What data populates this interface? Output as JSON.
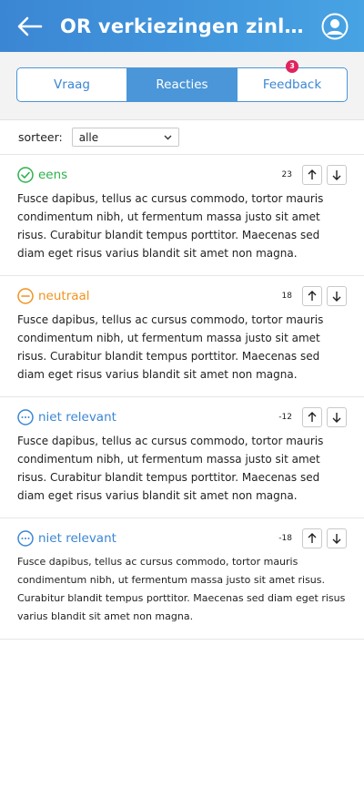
{
  "header": {
    "title": "OR verkiezingen zinlo...",
    "back_icon": "arrow-left-icon",
    "avatar_icon": "user-avatar-icon"
  },
  "tabs": [
    {
      "label": "Vraag",
      "active": false
    },
    {
      "label": "Reacties",
      "active": true
    },
    {
      "label": "Feedback",
      "active": false,
      "badge": "3"
    }
  ],
  "sort": {
    "label": "sorteer:",
    "selected": "alle"
  },
  "replies": [
    {
      "status": "eens",
      "status_icon": "check-circle-icon",
      "color": "#2bb24c",
      "score": "23",
      "text": "Fusce dapibus, tellus ac cursus commodo, tortor mauris condimentum nibh, ut fermentum massa justo sit amet risus. Curabitur blandit tempus porttitor. Maecenas sed diam eget risus varius blandit sit amet non magna."
    },
    {
      "status": "neutraal",
      "status_icon": "minus-circle-icon",
      "color": "#f0931e",
      "score": "18",
      "text": "Fusce dapibus, tellus ac cursus commodo, tortor mauris condimentum nibh, ut fermentum massa justo sit amet risus. Curabitur blandit tempus porttitor. Maecenas sed diam eget risus varius blandit sit amet non magna."
    },
    {
      "status": "niet relevant",
      "status_icon": "dots-circle-icon",
      "color": "#3b86d4",
      "score": "-12",
      "text": "Fusce dapibus, tellus ac cursus commodo, tortor mauris condimentum nibh, ut fermentum massa justo sit amet risus. Curabitur blandit tempus porttitor. Maecenas sed diam eget risus varius blandit sit amet non magna."
    },
    {
      "status": "niet relevant",
      "status_icon": "dots-circle-icon",
      "color": "#3b86d4",
      "score": "-18",
      "text": "Fusce dapibus, tellus ac cursus commodo, tortor mauris condimentum nibh, ut fermentum massa justo sit amet risus. Curabitur blandit tempus porttitor. Maecenas sed diam eget risus varius blandit sit amet non magna."
    }
  ],
  "colors": {
    "accent": "#4a96d8",
    "badge": "#e0245e"
  }
}
